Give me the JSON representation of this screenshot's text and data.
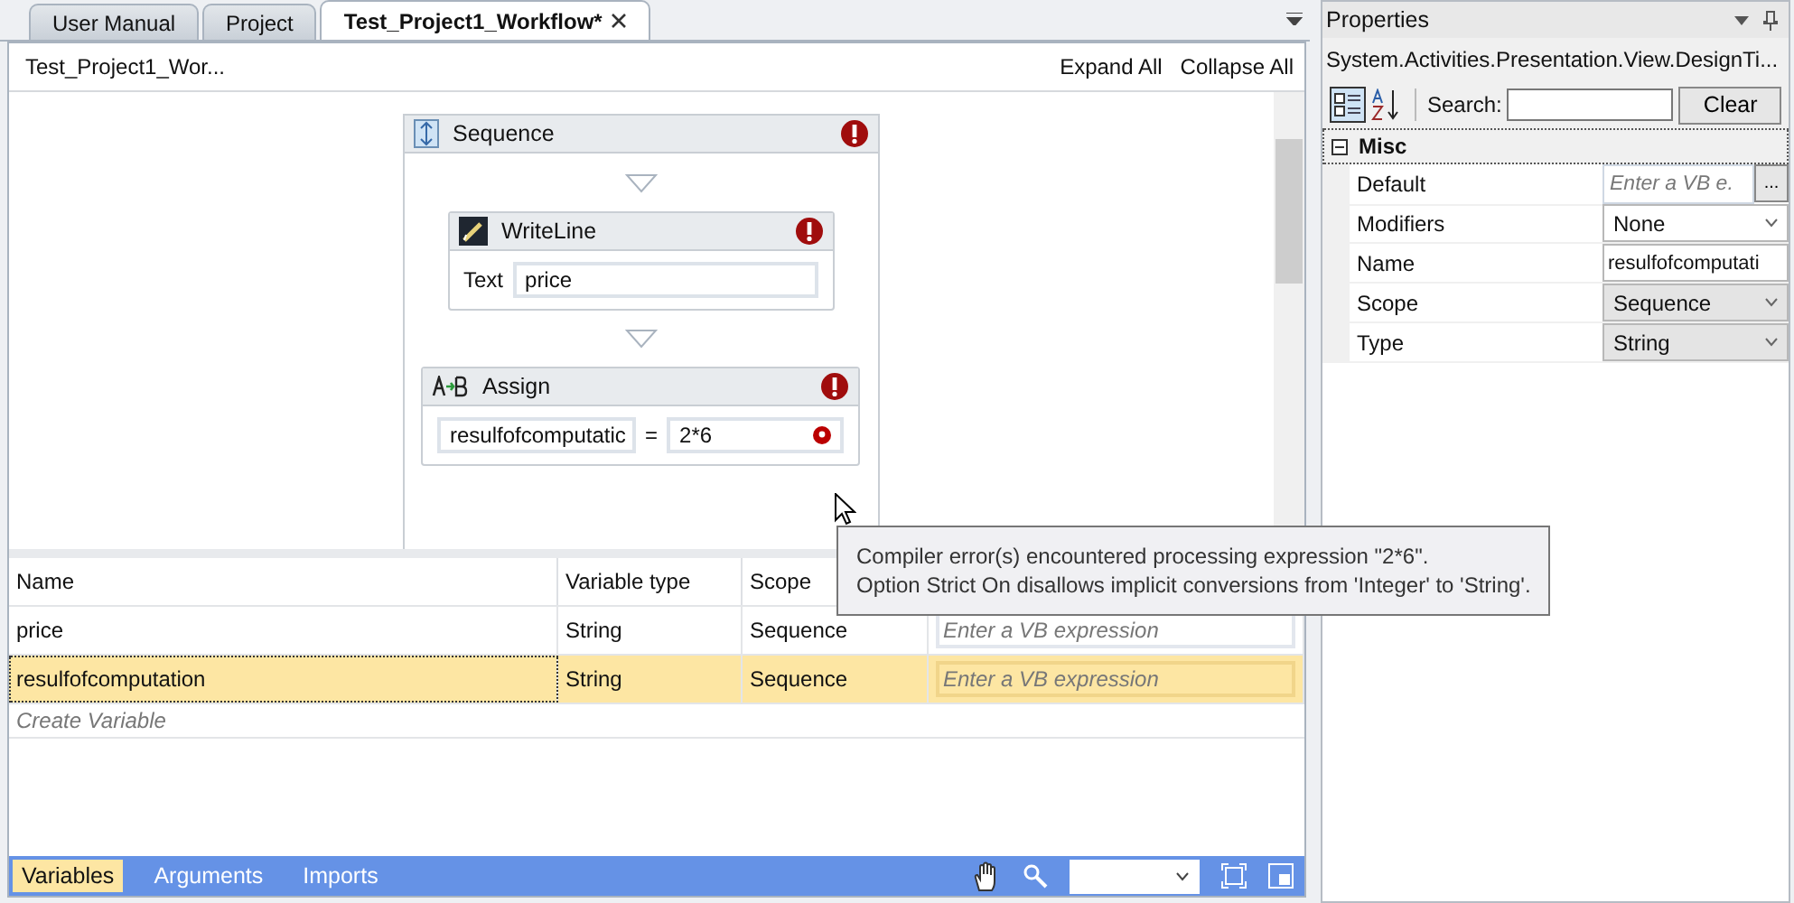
{
  "tabs": [
    {
      "label": "User Manual",
      "selected": false,
      "closable": false
    },
    {
      "label": "Project",
      "selected": false,
      "closable": false
    },
    {
      "label": "Test_Project1_Workflow*",
      "selected": true,
      "closable": true
    }
  ],
  "designer": {
    "breadcrumb": "Test_Project1_Wor...",
    "expand_all": "Expand All",
    "collapse_all": "Collapse All",
    "sequence": {
      "title": "Sequence",
      "error": true
    },
    "writeline": {
      "title": "WriteLine",
      "error": true,
      "text_label": "Text",
      "text_value": "price"
    },
    "assign": {
      "title": "Assign",
      "error": true,
      "to": "resulfofcomputatic",
      "equals": "=",
      "value": "2*6",
      "value_error": true
    },
    "tooltip": {
      "lines": [
        "Compiler error(s) encountered processing expression \"2*6\".",
        "Option Strict On disallows implicit conversions from 'Integer' to 'String'."
      ]
    }
  },
  "variables": {
    "columns": [
      "Name",
      "Variable type",
      "Scope"
    ],
    "rows": [
      {
        "name": "price",
        "type": "String",
        "scope": "Sequence",
        "default_placeholder": "Enter a VB expression",
        "selected": false
      },
      {
        "name": "resulfofcomputation",
        "type": "String",
        "scope": "Sequence",
        "default_placeholder": "Enter a VB expression",
        "selected": true
      }
    ],
    "create_variable": "Create Variable"
  },
  "bottom_tabs": [
    {
      "label": "Variables",
      "selected": true
    },
    {
      "label": "Arguments",
      "selected": false
    },
    {
      "label": "Imports",
      "selected": false
    }
  ],
  "properties": {
    "title": "Properties",
    "type_name": "System.Activities.Presentation.View.DesignTi...",
    "search_label": "Search:",
    "clear": "Clear",
    "category": {
      "name": "Misc",
      "expanded": true
    },
    "rows": [
      {
        "label": "Default",
        "kind": "expression",
        "placeholder": "Enter a VB e.",
        "button": "..."
      },
      {
        "label": "Modifiers",
        "kind": "combo",
        "value": "None"
      },
      {
        "label": "Name",
        "kind": "text",
        "value": "resulfofcomputati"
      },
      {
        "label": "Scope",
        "kind": "dropdown",
        "value": "Sequence"
      },
      {
        "label": "Type",
        "kind": "dropdown",
        "value": "String"
      }
    ]
  }
}
